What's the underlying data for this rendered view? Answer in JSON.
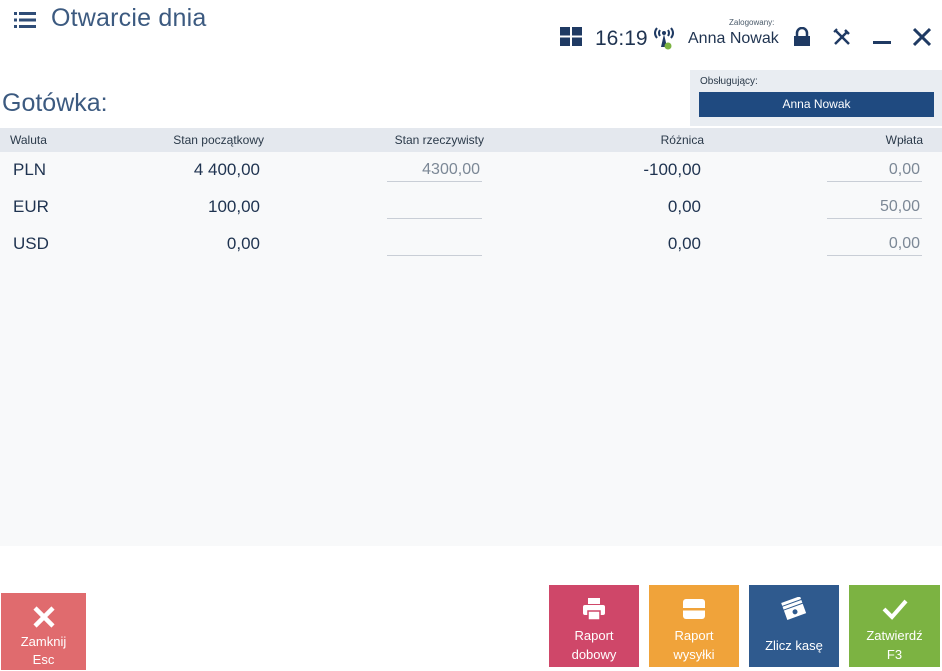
{
  "window": {
    "title": "Otwarcie dnia",
    "clock": "16:19",
    "logged_label": "Zalogowany:",
    "logged_user": "Anna Nowak"
  },
  "section": {
    "title": "Gotówka:"
  },
  "operator": {
    "label": "Obsługujący:",
    "selected": "Anna Nowak"
  },
  "table": {
    "headers": {
      "currency": "Waluta",
      "start": "Stan początkowy",
      "actual": "Stan rzeczywisty",
      "diff": "Różnica",
      "deposit": "Wpłata"
    },
    "rows": [
      {
        "currency": "PLN",
        "start": "4 400,00",
        "actual": "4300,00",
        "diff": "-100,00",
        "deposit": "0,00"
      },
      {
        "currency": "EUR",
        "start": "100,00",
        "actual": "",
        "diff": "0,00",
        "deposit": "50,00"
      },
      {
        "currency": "USD",
        "start": "0,00",
        "actual": "",
        "diff": "0,00",
        "deposit": "0,00"
      }
    ]
  },
  "buttons": {
    "close": {
      "line1": "Zamknij",
      "line2": "Esc"
    },
    "daily": {
      "line1": "Raport",
      "line2": "dobowy"
    },
    "shipment": {
      "line1": "Raport",
      "line2": "wysyłki"
    },
    "count": {
      "line1": "Zlicz kasę"
    },
    "confirm": {
      "line1": "Zatwierdź",
      "line2": "F3"
    }
  },
  "colors": {
    "title": "#3c5a80",
    "operator_select": "#1f4a80",
    "close_button": "#e06b6e",
    "daily_button": "#cf4769",
    "shipment_button": "#f0a33a",
    "count_button": "#2f5a8e",
    "confirm_button": "#7cb342"
  },
  "icons": [
    "menu-icon",
    "tiles-icon",
    "signal-icon",
    "lock-icon",
    "tools-icon",
    "minimize-icon",
    "close-icon",
    "x-icon",
    "printer-icon",
    "card-icon",
    "cash-icon",
    "check-icon"
  ]
}
